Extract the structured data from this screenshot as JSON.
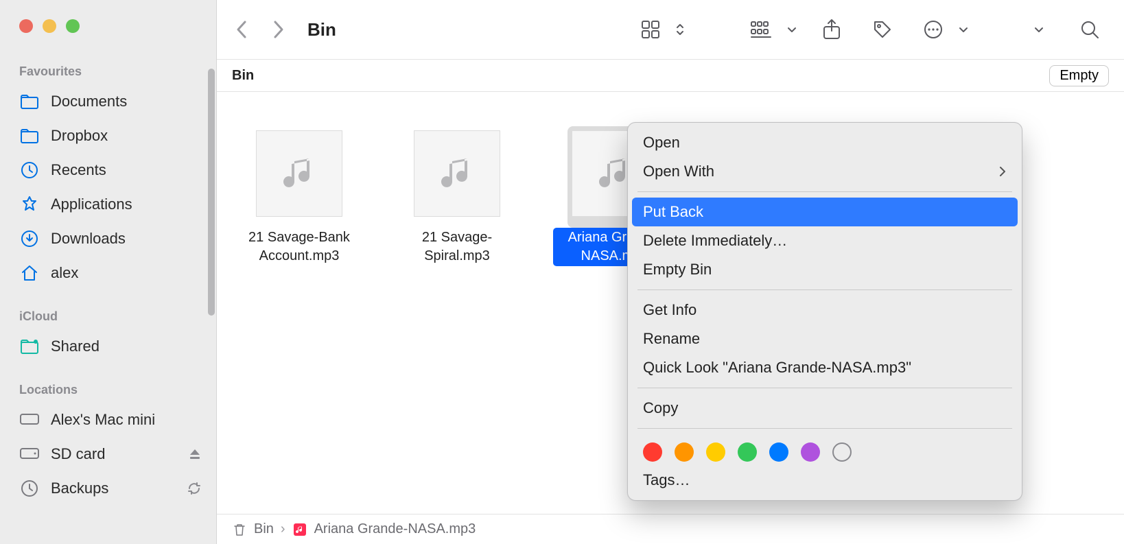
{
  "window": {
    "title": "Bin"
  },
  "sidebar": {
    "favourites_label": "Favourites",
    "favourites": [
      {
        "label": "Documents"
      },
      {
        "label": "Dropbox"
      },
      {
        "label": "Recents"
      },
      {
        "label": "Applications"
      },
      {
        "label": "Downloads"
      },
      {
        "label": "alex"
      }
    ],
    "icloud_label": "iCloud",
    "icloud": [
      {
        "label": "Shared"
      }
    ],
    "locations_label": "Locations",
    "locations": [
      {
        "label": "Alex's Mac mini"
      },
      {
        "label": "SD card"
      },
      {
        "label": "Backups"
      }
    ]
  },
  "subheader": {
    "title": "Bin",
    "empty_label": "Empty"
  },
  "files": [
    {
      "label": "21 Savage-Bank Account.mp3",
      "selected": false
    },
    {
      "label": "21 Savage-Spiral.mp3",
      "selected": false
    },
    {
      "label": "Ariana Grande-NASA.mp3",
      "selected": true
    }
  ],
  "pathbar": {
    "root": "Bin",
    "current": "Ariana Grande-NASA.mp3"
  },
  "context_menu": {
    "open": "Open",
    "open_with": "Open With",
    "put_back": "Put Back",
    "delete_immediately": "Delete Immediately…",
    "empty_bin": "Empty Bin",
    "get_info": "Get Info",
    "rename": "Rename",
    "quick_look": "Quick Look \"Ariana Grande-NASA.mp3\"",
    "copy": "Copy",
    "tags": "Tags…",
    "tag_colors": [
      "#ff3b30",
      "#ff9500",
      "#ffcc00",
      "#34c759",
      "#007aff",
      "#af52de"
    ]
  }
}
